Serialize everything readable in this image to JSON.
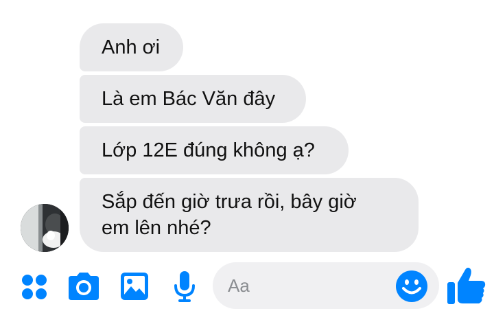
{
  "messages": [
    {
      "text": "Anh ơi"
    },
    {
      "text": "Là em Bác Văn đây"
    },
    {
      "text": "Lớp 12E đúng không ạ?"
    },
    {
      "line1": "Sắp đến giờ trưa rồi, bây giờ",
      "line2": "em lên nhé?"
    }
  ],
  "composer": {
    "placeholder": "Aa"
  },
  "icons": {
    "more": "more-apps-icon",
    "camera": "camera-icon",
    "gallery": "image-icon",
    "mic": "microphone-icon",
    "emoji": "emoji-icon",
    "like": "thumbs-up-icon"
  },
  "colors": {
    "accent": "#0084ff",
    "bubble": "#e9e9eb",
    "input_bg": "#f0f0f2"
  }
}
